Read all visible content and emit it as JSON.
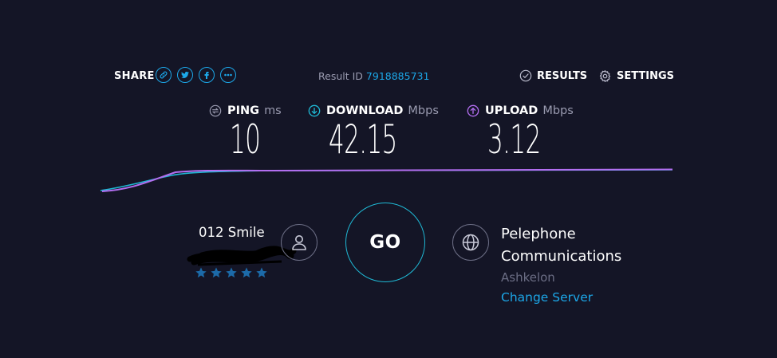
{
  "share": {
    "label": "SHARE",
    "buttons": [
      "link-icon",
      "twitter-icon",
      "facebook-icon",
      "more-icon"
    ]
  },
  "result": {
    "label": "Result ID",
    "id": "7918885731"
  },
  "nav": {
    "results_label": "RESULTS",
    "settings_label": "SETTINGS"
  },
  "metrics": {
    "ping": {
      "label": "PING",
      "unit": "ms",
      "value": "10",
      "icon": "ping-icon"
    },
    "download": {
      "label": "DOWNLOAD",
      "unit": "Mbps",
      "value": "42.15",
      "icon": "download-icon",
      "color": "#1fb8d4"
    },
    "upload": {
      "label": "UPLOAD",
      "unit": "Mbps",
      "value": "3.12",
      "icon": "upload-icon",
      "color": "#b36ef0"
    }
  },
  "provider": {
    "name": "012 Smile",
    "rating_stars": 5,
    "star_color": "#1c6aa8"
  },
  "go": {
    "label": "GO"
  },
  "server": {
    "name_line1": "Pelephone",
    "name_line2": "Communications",
    "location": "Ashkelon",
    "change_label": "Change Server"
  },
  "colors": {
    "background": "#141526",
    "accent": "#1ca7e8",
    "download_line": "#1fb8d4",
    "upload_line": "#b36ef0",
    "muted": "#6b6d84"
  }
}
